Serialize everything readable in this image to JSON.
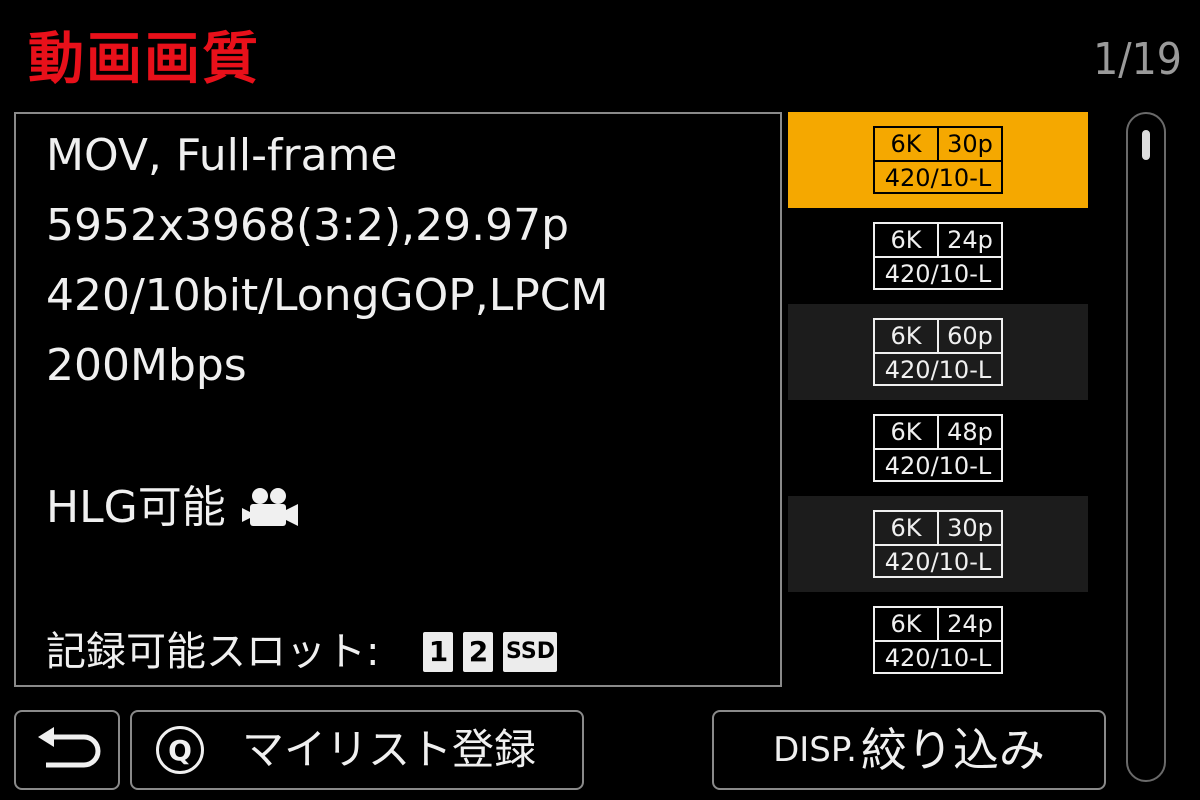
{
  "header": {
    "title": "動画画質",
    "page_counter": "1/19"
  },
  "details": {
    "lines": [
      "MOV, Full-frame",
      "5952x3968(3:2),29.97p",
      "420/10bit/LongGOP,LPCM",
      "200Mbps"
    ],
    "hlg_text": "HLG可能",
    "hlg_icon": "movie-camera-icon",
    "slot_label": "記録可能スロット:",
    "slots": [
      "1",
      "2",
      "SSD"
    ]
  },
  "modes": [
    {
      "res": "6K",
      "fps": "30p",
      "format": "420/10-L",
      "selected": true
    },
    {
      "res": "6K",
      "fps": "24p",
      "format": "420/10-L"
    },
    {
      "res": "6K",
      "fps": "60p",
      "format": "420/10-L"
    },
    {
      "res": "6K",
      "fps": "48p",
      "format": "420/10-L"
    },
    {
      "res": "6K",
      "fps": "30p",
      "format": "420/10-L"
    },
    {
      "res": "6K",
      "fps": "24p",
      "format": "420/10-L"
    }
  ],
  "footer": {
    "back_icon": "return-arrow-icon",
    "q_key": "Q",
    "mylist_label": "マイリスト登録",
    "disp_key": "DISP.",
    "filter_label": "絞り込み"
  },
  "colors": {
    "title": "#e8101a",
    "selected": "#f5a800",
    "background": "#000000"
  }
}
